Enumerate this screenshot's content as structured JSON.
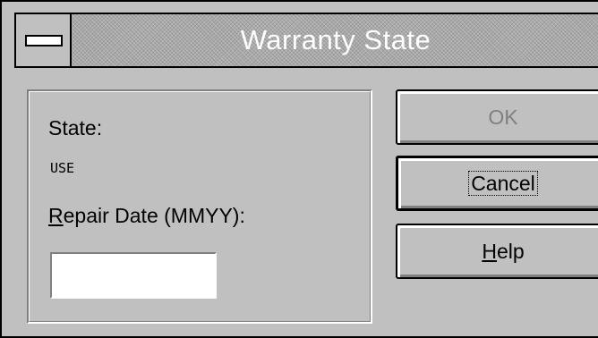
{
  "window": {
    "title": "Warranty State",
    "system_menu_icon": "system-menu-bar-icon"
  },
  "form": {
    "state_label": "State:",
    "state_value": "USE",
    "repair_date_label_accel": "R",
    "repair_date_label_rest": "epair Date (MMYY):",
    "repair_date_value": "",
    "repair_date_placeholder": ""
  },
  "buttons": {
    "ok_label": "OK",
    "ok_enabled": false,
    "cancel_label": "Cancel",
    "help_label_accel": "H",
    "help_label_rest": "elp"
  },
  "colors": {
    "dialog_face": "#c0c0c0",
    "title_text": "#ffffff",
    "disabled_text": "#808080"
  }
}
